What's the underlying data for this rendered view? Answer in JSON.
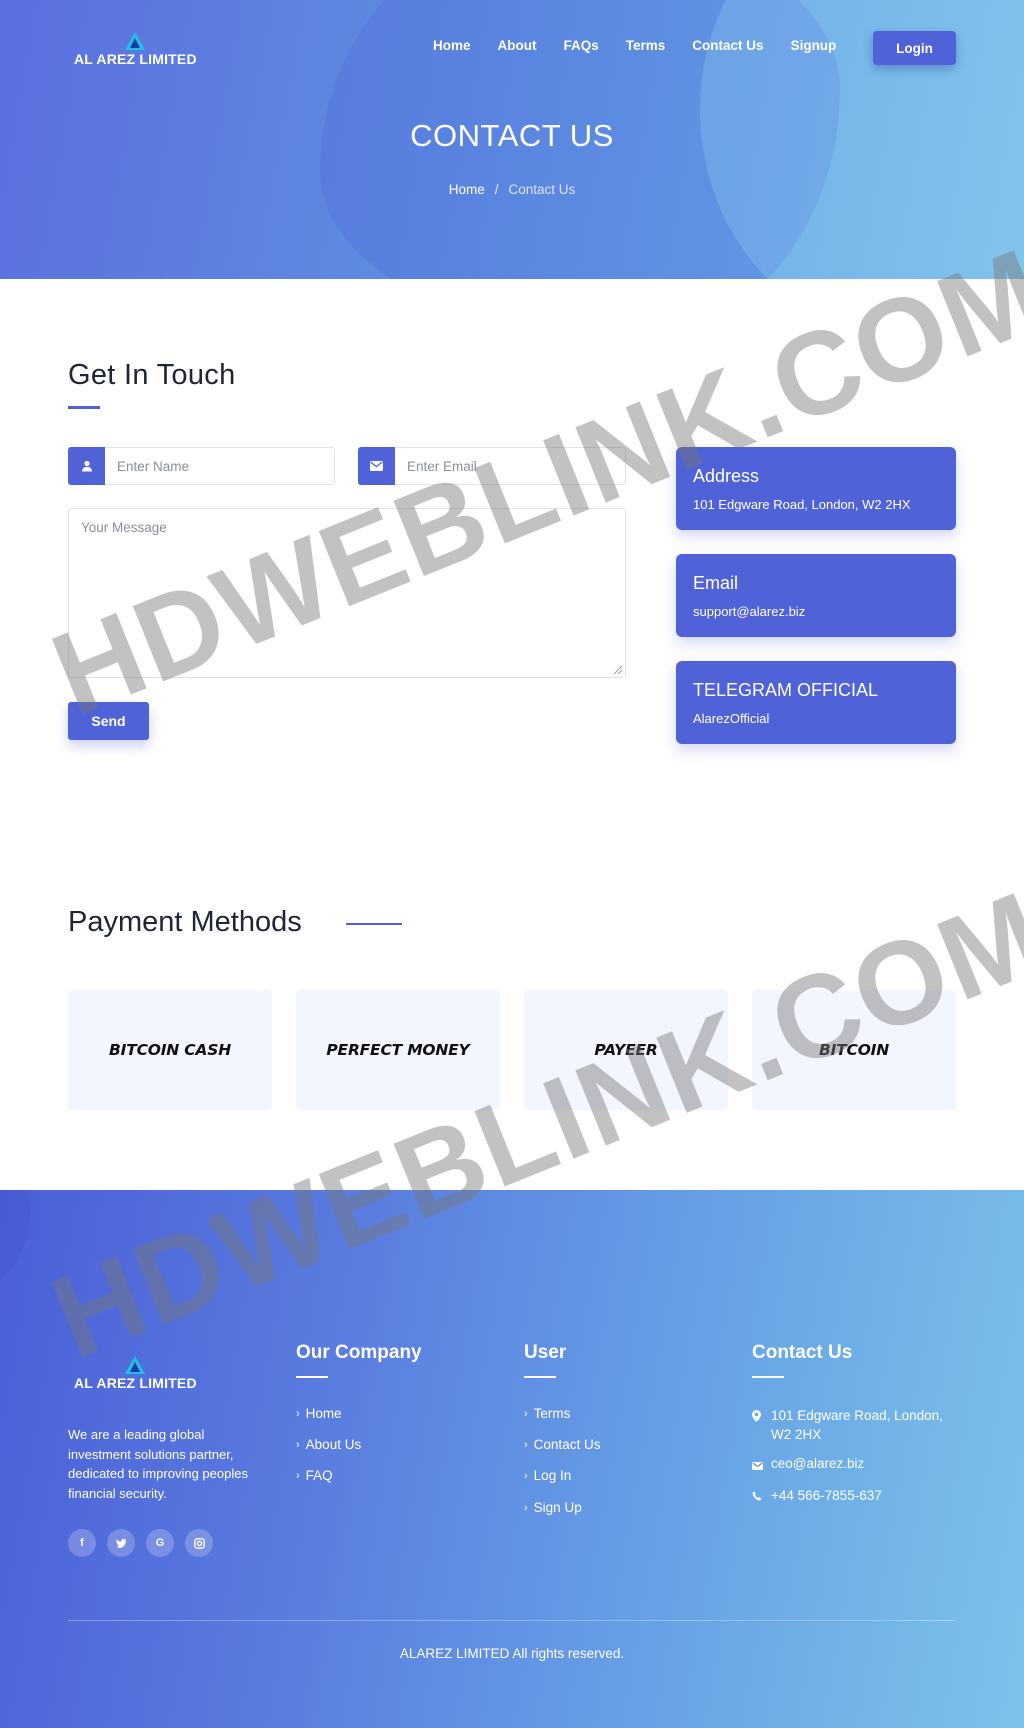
{
  "brand": {
    "name": "AL AREZ LIMITED",
    "logo_icon": "triangle-logo-icon"
  },
  "nav": {
    "items": [
      "Home",
      "About",
      "FAQs",
      "Terms",
      "Contact Us",
      "Signup"
    ],
    "login_label": "Login"
  },
  "hero": {
    "title": "CONTACT US",
    "breadcrumb": {
      "home": "Home",
      "separator": "/",
      "current": "Contact Us"
    }
  },
  "contact": {
    "heading": "Get In Touch",
    "name_placeholder": "Enter Name",
    "email_placeholder": "Enter Email",
    "message_placeholder": "Your Message",
    "send_label": "Send",
    "cards": [
      {
        "title": "Address",
        "value": "101 Edgware Road, London, W2 2HX"
      },
      {
        "title": "Email",
        "value": "support@alarez.biz"
      },
      {
        "title": "TELEGRAM OFFICIAL",
        "value": "AlarezOfficial"
      }
    ]
  },
  "payment": {
    "heading": "Payment Methods",
    "methods": [
      "BITCOIN CASH",
      "PERFECT MONEY",
      "PAYEER",
      "BITCOIN"
    ]
  },
  "footer": {
    "brand": "AL AREZ LIMITED",
    "about": "We are a leading global investment solutions partner, dedicated to improving peoples financial security.",
    "socials": [
      "facebook-icon",
      "twitter-icon",
      "google-icon",
      "instagram-icon"
    ],
    "company": {
      "heading": "Our Company",
      "links": [
        "Home",
        "About Us",
        "FAQ"
      ]
    },
    "user": {
      "heading": "User",
      "links": [
        "Terms",
        "Contact Us",
        "Log In",
        "Sign Up"
      ]
    },
    "contact": {
      "heading": "Contact Us",
      "address_line1": "101 Edgware Road, London,",
      "address_line2": "W2 2HX",
      "email": "ceo@alarez.biz",
      "phone": "+44 566-7855-637"
    },
    "copyright": "ALAREZ LIMITED All rights reserved."
  },
  "watermark": "HDWEBLINK.COM",
  "colors": {
    "accent": "#4f62d8",
    "card_bg": "#f3f6ff",
    "heading": "#1f2436"
  }
}
